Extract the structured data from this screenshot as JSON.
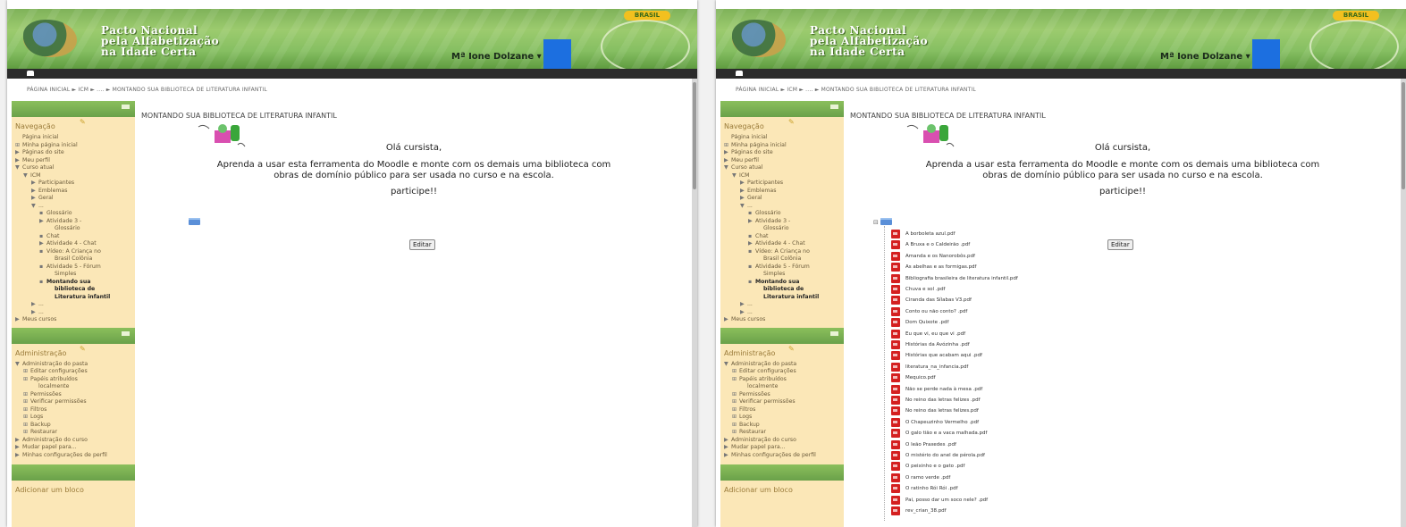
{
  "header": {
    "brasil_badge": "BRASIL",
    "title_lines": [
      "Pacto Nacional",
      "pela Alfabetização",
      "na Idade Certa"
    ],
    "user_name": "Mª Ione Dolzane"
  },
  "breadcrumb": "PÁGINA INICIAL ► ICM ► .... ► MONTANDO SUA BIBLIOTECA DE LITERATURA INFANTIL",
  "navigation": {
    "title": "Navegação",
    "items": [
      {
        "text": "Página inicial",
        "marker": "",
        "level": 0
      },
      {
        "text": "Minha página inicial",
        "marker": "⊞",
        "level": 0
      },
      {
        "text": "Páginas do site",
        "marker": "▶",
        "level": 0
      },
      {
        "text": "Meu perfil",
        "marker": "▶",
        "level": 0
      },
      {
        "text": "Curso atual",
        "marker": "▼",
        "level": 0
      },
      {
        "text": "ICM",
        "marker": "▼",
        "level": 1
      },
      {
        "text": "Participantes",
        "marker": "▶",
        "level": 2
      },
      {
        "text": "Emblemas",
        "marker": "▶",
        "level": 2
      },
      {
        "text": "Geral",
        "marker": "▶",
        "level": 2
      },
      {
        "text": "...",
        "marker": "▼",
        "level": 2
      },
      {
        "text": "Glossário",
        "marker": "▪",
        "level": 3
      },
      {
        "text": "Atividade 3 -",
        "marker": "▶",
        "level": 3
      },
      {
        "text": "Glossário",
        "marker": "",
        "level": 4
      },
      {
        "text": "Chat",
        "marker": "▪",
        "level": 3
      },
      {
        "text": "Atividade 4 - Chat",
        "marker": "▶",
        "level": 3
      },
      {
        "text": "Vídeo: A Criança no",
        "marker": "▪",
        "level": 3
      },
      {
        "text": "Brasil Colônia",
        "marker": "",
        "level": 4
      },
      {
        "text": "Atividade 5 - Fórum",
        "marker": "▪",
        "level": 3
      },
      {
        "text": "Simples",
        "marker": "",
        "level": 4
      },
      {
        "text": "Montando sua",
        "marker": "▪",
        "level": 3,
        "active": true
      },
      {
        "text": "biblioteca de",
        "marker": "",
        "level": 4,
        "active": true
      },
      {
        "text": "Literatura infantil",
        "marker": "",
        "level": 4,
        "active": true
      },
      {
        "text": "...",
        "marker": "▶",
        "level": 2
      },
      {
        "text": "...",
        "marker": "▶",
        "level": 2
      },
      {
        "text": "Meus cursos",
        "marker": "▶",
        "level": 0
      }
    ]
  },
  "administration": {
    "title": "Administração",
    "items": [
      {
        "text": "Administração do pasta",
        "marker": "▼",
        "level": 0
      },
      {
        "text": "Editar configurações",
        "marker": "⊞",
        "level": 1
      },
      {
        "text": "Papéis atribuídos",
        "marker": "⊞",
        "level": 1
      },
      {
        "text": "localmente",
        "marker": "",
        "level": 2
      },
      {
        "text": "Permissões",
        "marker": "⊞",
        "level": 1
      },
      {
        "text": "Verificar permissões",
        "marker": "⊞",
        "level": 1
      },
      {
        "text": "Filtros",
        "marker": "⊞",
        "level": 1
      },
      {
        "text": "Logs",
        "marker": "⊞",
        "level": 1
      },
      {
        "text": "Backup",
        "marker": "⊞",
        "level": 1
      },
      {
        "text": "Restaurar",
        "marker": "⊞",
        "level": 1
      },
      {
        "text": "Administração do curso",
        "marker": "▶",
        "level": 0
      },
      {
        "text": "Mudar papel para...",
        "marker": "▶",
        "level": 0
      },
      {
        "text": "Minhas configurações de perfil",
        "marker": "▶",
        "level": 0
      }
    ]
  },
  "add_block": "Adicionar um bloco",
  "content": {
    "page_title": "MONTANDO SUA BIBLIOTECA DE LITERATURA INFANTIL",
    "greeting": "Olá cursista,",
    "instruction_line1": "Aprenda a usar esta ferramenta do Moodle e monte com os demais uma biblioteca com",
    "instruction_line2": "obras de domínio público para ser usada no curso e na escola.",
    "call": "participe!!",
    "edit_button": "Editar",
    "files": [
      "A borboleta azul.pdf",
      "A Bruxa e o Caldeirão .pdf",
      "Amanda e os Nanorobôs.pdf",
      "As abelhas e as formigas.pdf",
      "Bibliografia brasileira de literatura infantil.pdf",
      "Chuva e sol .pdf",
      "Ciranda das Sílabas V3.pdf",
      "Conto ou não conto? .pdf",
      "Dom Quixote .pdf",
      "Eu que vi, eu que vi .pdf",
      "Histórias da Avózinha .pdf",
      "Histórias que acabam aqui .pdf",
      "literatura_na_infancia.pdf",
      "Mequico.pdf",
      "Não se perde nada à mesa .pdf",
      "No reino das letras felizes .pdf",
      "No reino das letras felizes.pdf",
      "O Chapeuzinho Vermelho .pdf",
      "O galo tião e a vaca malhada.pdf",
      "O leão Praxedes .pdf",
      "O mistério do anel de pérola.pdf",
      "O peixinho e o gato .pdf",
      "O ramo verde .pdf",
      "O ratinho Rói Rói .pdf",
      "Pai, posso dar um soco nele? .pdf",
      "rev_crian_38.pdf"
    ]
  },
  "colors": {
    "header_green": "#86bf62",
    "sidebar_bg": "#fbe7b7",
    "navbar": "#2b2b2b",
    "pdf_red": "#d42020",
    "folder_blue": "#5a8fd8"
  }
}
